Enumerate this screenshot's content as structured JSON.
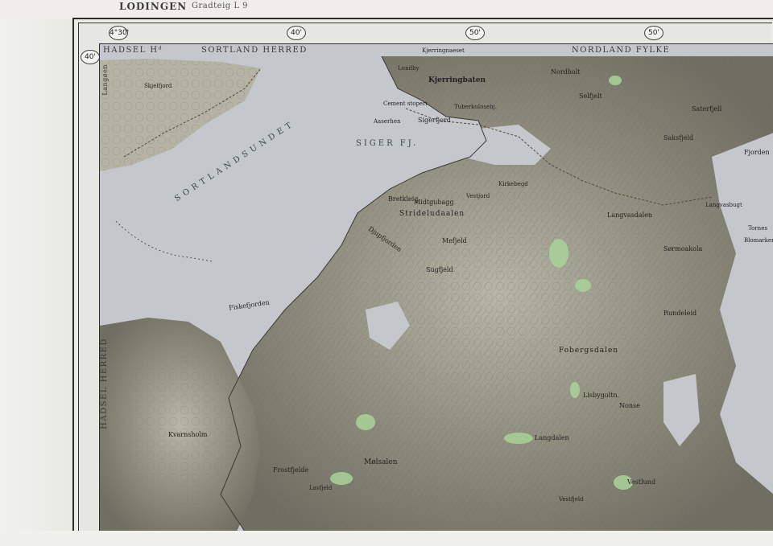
{
  "sheet": {
    "title": "LODINGEN",
    "subtitle": "Gradteig L 9"
  },
  "graticule": {
    "top": [
      "4°30'",
      "40'",
      "50'",
      "50'"
    ],
    "side": "40'"
  },
  "edge_labels": {
    "hadsel_hd": "HADSEL Hᵈ",
    "sortland_herred": "SORTLAND HERRED",
    "nordland_fylke": "NORDLAND FYLKE",
    "hadsel_herred": "HADSEL HERRED",
    "langoen": "Langøen"
  },
  "water_labels": {
    "sortlandsundet": "SORTLANDSUNDET",
    "sigerfjord": "SIGER FJ."
  },
  "places": [
    "Skjelfjord",
    "Kjerringnaeset",
    "Kjerringbaten",
    "Lundby",
    "Cement stoperi",
    "Tuberkulosehj.",
    "Sigerfjord",
    "Aaserhen",
    "Bretkleig",
    "Midtgubagg",
    "Strideludaalen",
    "Vestjord",
    "Kirkebegd",
    "Nordholt",
    "Selfjelt",
    "Saksfjeld",
    "Fiskefjorden",
    "Djupfjorden",
    "Sugfjeld",
    "Mefjeld",
    "Langvasdalen",
    "Sørmoakola",
    "Rundeleid",
    "Fobergsdalen",
    "Lisbygoltn.",
    "Nonse",
    "Vestfjeld",
    "Lavfjeld",
    "Mølsalen",
    "Langdalen",
    "Kvarnsholm",
    "Frostfjelde",
    "Fjorden",
    "Langvasbugt",
    "Tornes",
    "Blomarken",
    "Saterfjell",
    "Vestlund"
  ]
}
